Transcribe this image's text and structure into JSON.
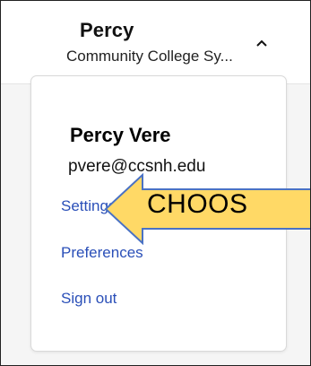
{
  "header": {
    "account_name": "Percy",
    "organization": "Community College Sy...",
    "toggle_icon": "chevron-up-icon"
  },
  "menu": {
    "user_name": "Percy Vere",
    "user_email": "pvere@ccsnh.edu",
    "items": [
      {
        "label": "Settings"
      },
      {
        "label": "Preferences"
      },
      {
        "label": "Sign out"
      }
    ],
    "link_color": "#2a4fb8"
  },
  "annotation": {
    "text": "CHOOS",
    "fill_color": "#ffd966",
    "stroke_color": "#4a72c4"
  }
}
